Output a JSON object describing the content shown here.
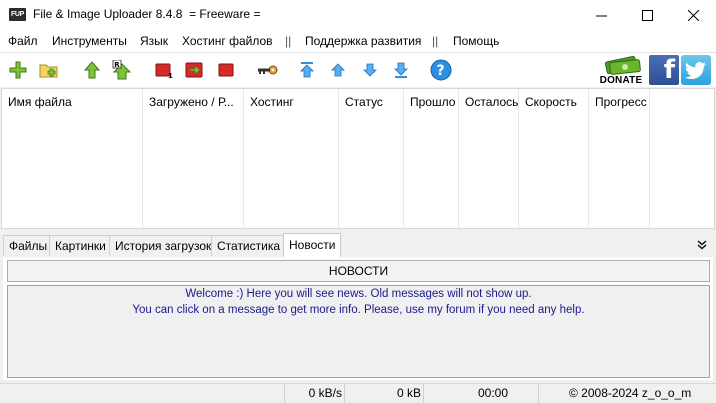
{
  "window": {
    "icon_text": "FUP",
    "title": "File & Image Uploader 8.4.8  = Freeware ="
  },
  "menu": {
    "items": [
      "Файл",
      "Инструменты",
      "Язык",
      "Хостинг файлов",
      "Поддержка развития",
      "Помощь"
    ],
    "separator": "||"
  },
  "toolbar": {
    "buttons": [
      "add-files-icon",
      "add-folder-icon",
      "upload-icon",
      "upload-resize-icon",
      "stop-icon",
      "stop-restart-icon",
      "stop-all-icon",
      "key-icon",
      "move-top-icon",
      "move-up-icon",
      "move-down-icon",
      "move-bottom-icon",
      "help-icon"
    ],
    "donate_label": "DONATE",
    "facebook_glyph": "f"
  },
  "table": {
    "columns": [
      "Имя файла",
      "Загружено / Р...",
      "Хостинг",
      "Статус",
      "Прошло",
      "Осталось",
      "Скорость",
      "Прогресс"
    ],
    "rows": []
  },
  "tabs": {
    "items": [
      "Файлы",
      "Картинки",
      "История загрузок",
      "Статистика",
      "Новости"
    ],
    "active": "Новости"
  },
  "news": {
    "header": "НОВОСТИ",
    "lines": [
      "Welcome :) Here you will see news. Old messages will not show up.",
      "You can click on a message to get more info. Please, use my forum if you need any help."
    ]
  },
  "status": {
    "speed": "0 kB/s",
    "size": "0 kB",
    "time": "00:00",
    "copyright": "© 2008-2024 z_o_o_m"
  },
  "colors": {
    "news_text": "#1a1a8a",
    "accent_blue": "#2e8fe0",
    "green_icon": "#6cb52a",
    "red_icon": "#d42a2a"
  }
}
